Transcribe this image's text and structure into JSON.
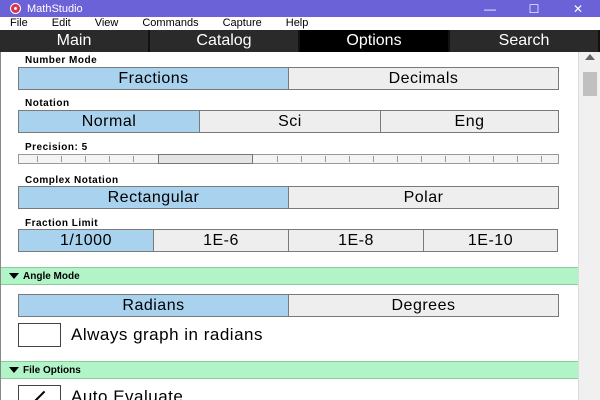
{
  "window": {
    "title": "MathStudio",
    "controls": {
      "minimize": "—",
      "maximize": "☐",
      "close": "✕"
    }
  },
  "menu": [
    "File",
    "Edit",
    "View",
    "Commands",
    "Capture",
    "Help"
  ],
  "tabs": [
    {
      "label": "Main",
      "active": false
    },
    {
      "label": "Catalog",
      "active": false
    },
    {
      "label": "Options",
      "active": true
    },
    {
      "label": "Search",
      "active": false
    }
  ],
  "number_mode": {
    "label": "Number Mode",
    "options": [
      "Fractions",
      "Decimals"
    ],
    "selected": "Fractions"
  },
  "notation": {
    "label": "Notation",
    "options": [
      "Normal",
      "Sci",
      "Eng"
    ],
    "selected": "Normal"
  },
  "precision": {
    "label": "Precision: 5",
    "value": 5
  },
  "complex_notation": {
    "label": "Complex Notation",
    "options": [
      "Rectangular",
      "Polar"
    ],
    "selected": "Rectangular"
  },
  "fraction_limit": {
    "label": "Fraction Limit",
    "options": [
      "1/1000",
      "1E-6",
      "1E-8",
      "1E-10"
    ],
    "selected": "1/1000"
  },
  "angle_mode": {
    "header": "Angle Mode",
    "options": [
      "Radians",
      "Degrees"
    ],
    "selected": "Radians",
    "always_graph_label": "Always graph in radians",
    "always_graph_checked": false
  },
  "file_options": {
    "header": "File Options",
    "auto_evaluate_label": "Auto Evaluate",
    "auto_evaluate_checked": true
  },
  "colors": {
    "selected": "#a8d2ee",
    "header_bg": "#b0f4c8",
    "titlebar": "#6a62d6"
  }
}
